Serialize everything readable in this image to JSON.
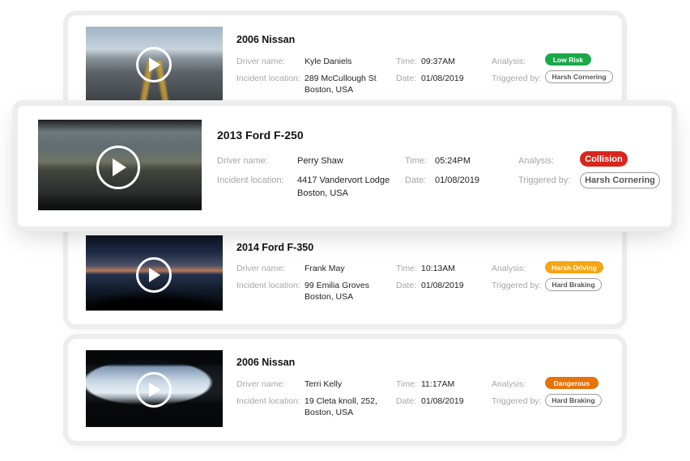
{
  "labels": {
    "driver_name": "Driver name:",
    "incident_location": "Incident location:",
    "time": "Time:",
    "date": "Date:",
    "analysis": "Analysis:",
    "triggered_by": "Triggered by:"
  },
  "incidents": [
    {
      "title": "2006 Nissan",
      "driver": "Kyle Daniels",
      "location_line1": "289 McCullough St",
      "location_line2": "Boston, USA",
      "time": "09:37AM",
      "date": "01/08/2019",
      "analysis": "Low Risk",
      "analysis_color": "#1aa84a",
      "trigger": "Harsh Cornering",
      "play_icon": "play-icon"
    },
    {
      "title": "2013 Ford F-250",
      "driver": "Perry Shaw",
      "location_line1": "4417 Vandervort Lodge",
      "location_line2": "Boston, USA",
      "time": "05:24PM",
      "date": "01/08/2019",
      "analysis": "Collision",
      "analysis_color": "#d9261c",
      "trigger": "Harsh Cornering",
      "play_icon": "play-icon"
    },
    {
      "title": "2014 Ford F-350",
      "driver": "Frank May",
      "location_line1": "99 Emilia Groves",
      "location_line2": "Boston, USA",
      "time": "10:13AM",
      "date": "01/08/2019",
      "analysis": "Harsh Driving",
      "analysis_color": "#f5a516",
      "trigger": "Hard Braking",
      "play_icon": "play-icon"
    },
    {
      "title": "2006 Nissan",
      "driver": "Terri Kelly",
      "location_line1": "19 Cleta knoll, 252,",
      "location_line2": "Boston, USA",
      "time": "11:17AM",
      "date": "01/08/2019",
      "analysis": "Dangerous",
      "analysis_color": "#e5720b",
      "trigger": "Hard Braking",
      "play_icon": "play-icon"
    }
  ]
}
